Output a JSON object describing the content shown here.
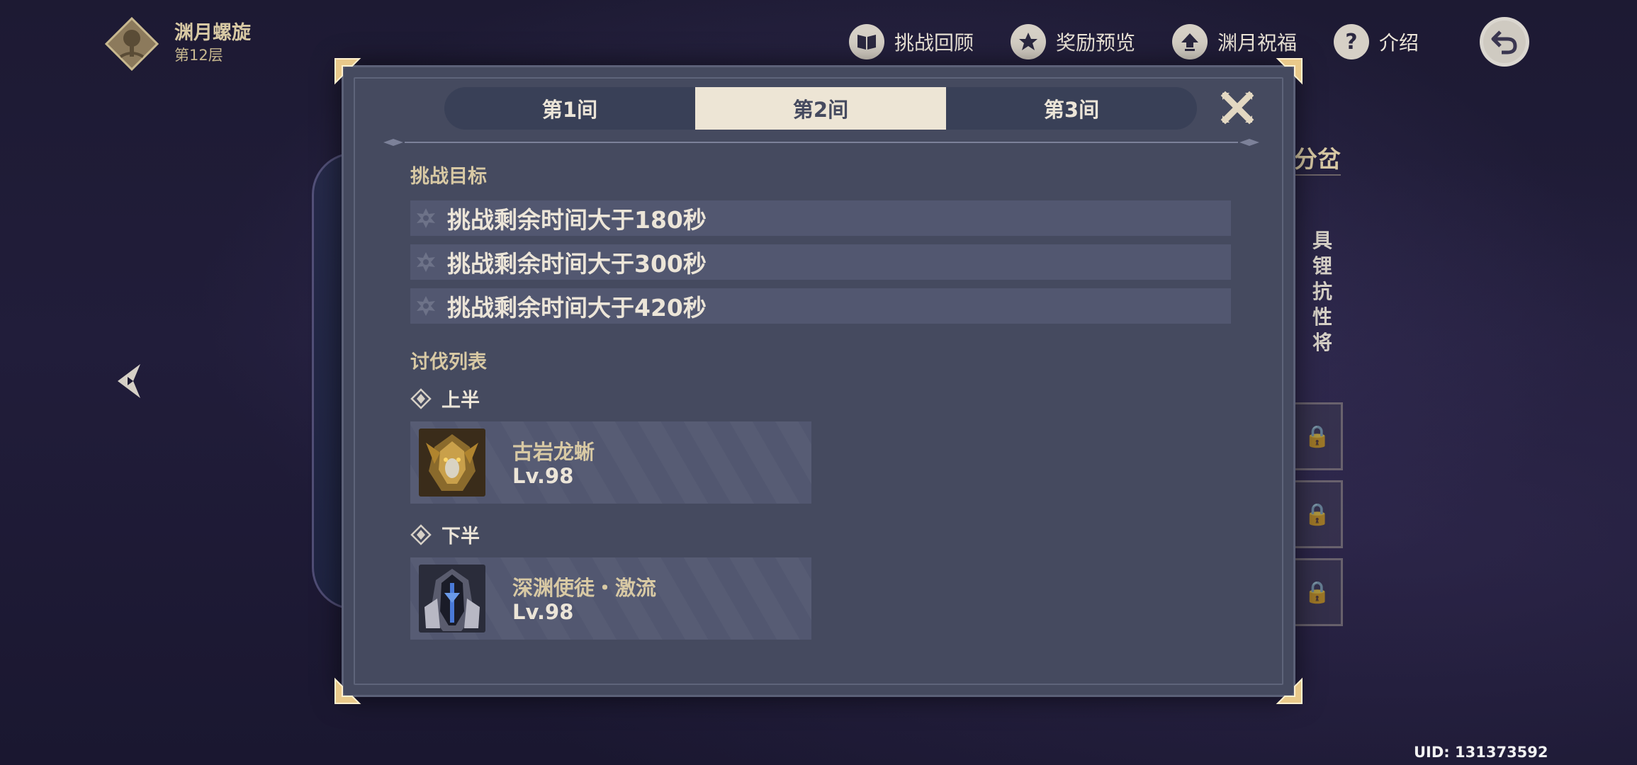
{
  "floor": {
    "title": "渊月螺旋",
    "subtitle": "第12层"
  },
  "topnav": [
    {
      "label": "挑战回顾",
      "icon": "book-icon"
    },
    {
      "label": "奖励预览",
      "icon": "star-badge-icon"
    },
    {
      "label": "渊月祝福",
      "icon": "upload-arrow-icon"
    },
    {
      "label": "介绍",
      "icon": "question-icon"
    }
  ],
  "background": {
    "right_title": "分岔",
    "right_text": [
      "具",
      "锂抗",
      "性将"
    ]
  },
  "dialog": {
    "tabs": [
      {
        "label": "第1间",
        "active": false
      },
      {
        "label": "第2间",
        "active": true
      },
      {
        "label": "第3间",
        "active": false
      }
    ],
    "goals_heading": "挑战目标",
    "goals": [
      "挑战剩余时间大于180秒",
      "挑战剩余时间大于300秒",
      "挑战剩余时间大于420秒"
    ],
    "enemy_heading": "讨伐列表",
    "halves": [
      {
        "label": "上半",
        "enemy": {
          "name": "古岩龙蜥",
          "level": "Lv.98"
        }
      },
      {
        "label": "下半",
        "enemy": {
          "name": "深渊使徒・激流",
          "level": "Lv.98"
        }
      }
    ]
  },
  "uid": "UID: 131373592",
  "colors": {
    "accent_gold": "#d8c9a4",
    "panel": "#454a5f",
    "tab_active": "#ede5d5"
  }
}
